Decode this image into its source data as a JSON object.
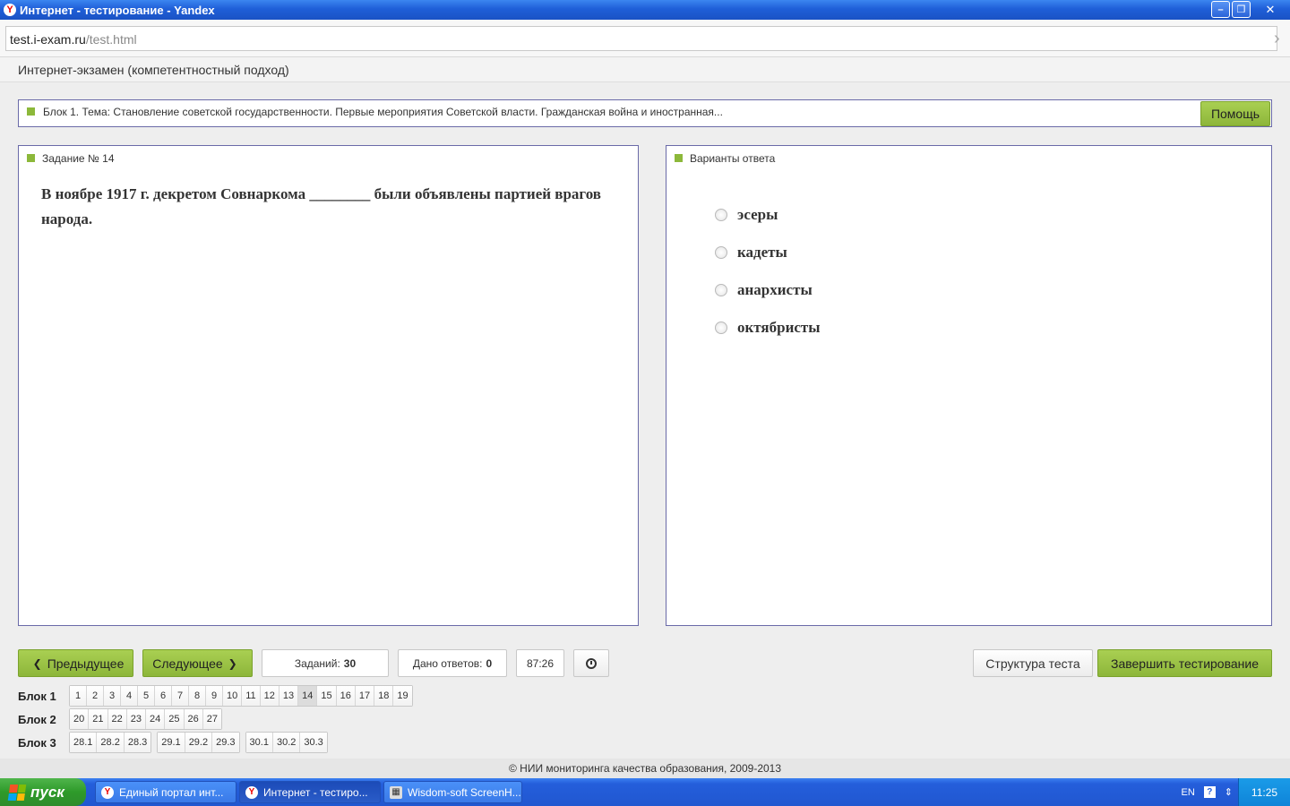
{
  "window": {
    "title": "Интернет - тестирование - Yandex",
    "minimize_glyph": "–",
    "restore_glyph": "❐",
    "close_glyph": "✕"
  },
  "browser": {
    "url_host": "test.i-exam.ru",
    "url_path": "/test.html"
  },
  "exam": {
    "header": "Интернет-экзамен (компетентностный подход)",
    "topic": "Блок 1. Тема: Становление советской государственности. Первые мероприятия Советской власти. Гражданская война и иностранная...",
    "help_label": "Помощь"
  },
  "task": {
    "title": "Задание № 14",
    "question": "В ноябре 1917 г. декретом Совнаркома ________ были объявлены партией врагов народа."
  },
  "answers": {
    "title": "Варианты ответа",
    "options": [
      "эсеры",
      "кадеты",
      "анархисты",
      "октябристы"
    ]
  },
  "controls": {
    "prev_label": "Предыдущее",
    "next_label": "Следующее",
    "tasks_label": "Заданий:",
    "tasks_count": "30",
    "answered_label": "Дано ответов:",
    "answered_count": "0",
    "timer": "87:26",
    "structure_label": "Структура теста",
    "finish_label": "Завершить тестирование"
  },
  "blocks": [
    {
      "label": "Блок 1",
      "groups": [
        [
          "1",
          "2",
          "3",
          "4",
          "5",
          "6",
          "7",
          "8",
          "9",
          "10",
          "11",
          "12",
          "13",
          "14",
          "15",
          "16",
          "17",
          "18",
          "19"
        ]
      ]
    },
    {
      "label": "Блок 2",
      "groups": [
        [
          "20",
          "21",
          "22",
          "23",
          "24",
          "25",
          "26",
          "27"
        ]
      ]
    },
    {
      "label": "Блок 3",
      "groups": [
        [
          "28.1",
          "28.2",
          "28.3"
        ],
        [
          "29.1",
          "29.2",
          "29.3"
        ],
        [
          "30.1",
          "30.2",
          "30.3"
        ]
      ]
    }
  ],
  "current_task": "14",
  "footer": "© НИИ мониторинга качества образования, 2009-2013",
  "taskbar": {
    "start_label": "пуск",
    "items": [
      "Единый портал инт...",
      "Интернет - тестиро...",
      "Wisdom-soft ScreenH..."
    ],
    "lang": "EN",
    "clock": "11:25"
  },
  "colors": {
    "accent_green": "#8db63a",
    "panel_border": "#6a6aa8",
    "titlebar_blue": "#1f5fd8"
  }
}
